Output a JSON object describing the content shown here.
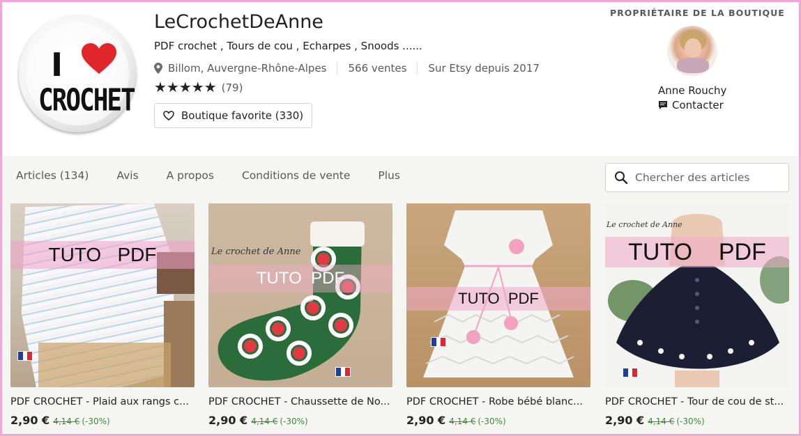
{
  "shop": {
    "name": "LeCrochetDeAnne",
    "tagline": "PDF crochet , Tours de cou , Echarpes , Snoods ......",
    "location": "Billom, Auvergne-Rhône-Alpes",
    "sales": "566 ventes",
    "since": "Sur Etsy depuis 2017",
    "stars": "★★★★★",
    "reviews_count": "(79)",
    "favorite_label": "Boutique favorite (330)",
    "logo": {
      "line1": "I",
      "line2": "CROCHET"
    }
  },
  "owner": {
    "label": "PROPRIÉTAIRE DE LA BOUTIQUE",
    "name": "Anne Rouchy",
    "contact": "Contacter"
  },
  "nav": {
    "tabs": [
      "Articles (134)",
      "Avis",
      "A propos",
      "Conditions de vente",
      "Plus"
    ],
    "search_placeholder": "Chercher des articles"
  },
  "listings": [
    {
      "title": "PDF CROCHET - Plaid aux rangs c...",
      "price": "2,90 €",
      "old_price": "4,14 €",
      "discount": "(-30%)",
      "overlay": "TUTO   PDF",
      "watermark": ""
    },
    {
      "title": "PDF CROCHET - Chaussette de No...",
      "price": "2,90 €",
      "old_price": "4,14 €",
      "discount": "(-30%)",
      "overlay": "TUTO  PDF",
      "watermark": "Le crochet de Anne"
    },
    {
      "title": "PDF CROCHET - Robe bébé blanc...",
      "price": "2,90 €",
      "old_price": "4,14 €",
      "discount": "(-30%)",
      "overlay": "TUTO  PDF",
      "watermark": ""
    },
    {
      "title": "PDF CROCHET - Tour de cou de st...",
      "price": "2,90 €",
      "old_price": "4,14 €",
      "discount": "(-30%)",
      "overlay": "TUTO    PDF",
      "watermark": "Le crochet de Anne"
    }
  ],
  "colors": {
    "frame": "#f0a6d6",
    "band": "#f2b9d3",
    "sale_green": "#3f8a3f",
    "nav_bg": "#f5f5f1"
  }
}
